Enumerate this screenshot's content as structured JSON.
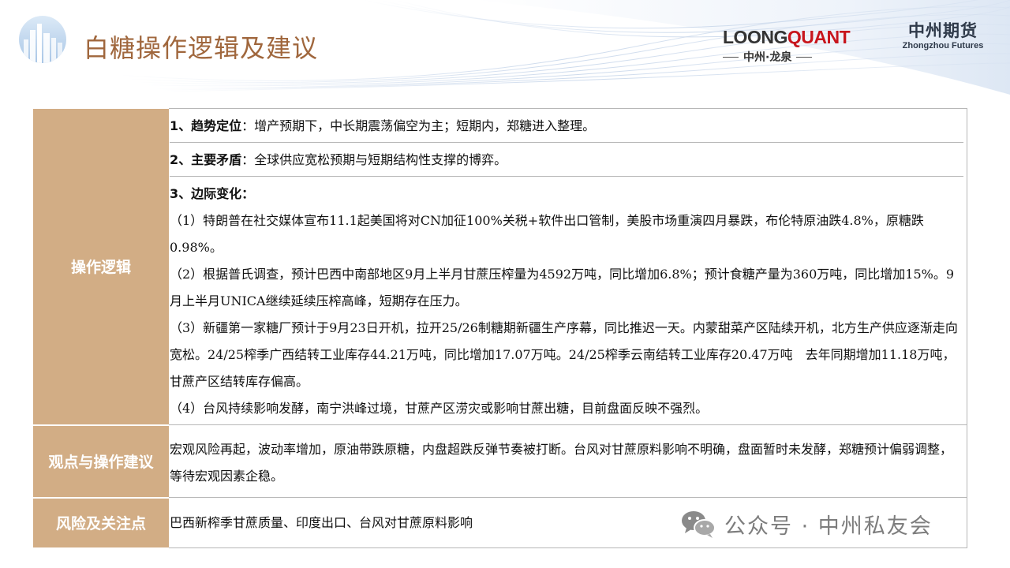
{
  "header": {
    "title": "白糖操作逻辑及建议",
    "brand_loong": "LOONG",
    "brand_quant": "QUANT",
    "brand_loong_sub": "中州·龙泉",
    "brand_zz_cn": "中州期货",
    "brand_zz_en": "Zhongzhou Futures"
  },
  "rows": {
    "logic": {
      "label": "操作逻辑",
      "trend": {
        "title": "1、趋势定位",
        "text": "：增产预期下，中长期震荡偏空为主；短期内，郑糖进入整理。"
      },
      "conflict": {
        "title": "2、主要矛盾",
        "text": "：全球供应宽松预期与短期结构性支撑的博弈。"
      },
      "margin": {
        "title": "3、边际变化：",
        "items": [
          "（1）特朗普在社交媒体宣布11.1起美国将对CN加征100%关税+软件出口管制，美股市场重演四月暴跌，布伦特原油跌4.8%，原糖跌0.98%。",
          "（2）根据普氏调查，预计巴西中南部地区9月上半月甘蔗压榨量为4592万吨，同比增加6.8%；预计食糖产量为360万吨，同比增加15%。9月上半月UNICA继续延续压榨高峰，短期存在压力。",
          "（3）新疆第一家糖厂预计于9月23日开机，拉开25/26制糖期新疆生产序幕，同比推迟一天。内蒙甜菜产区陆续开机，北方生产供应逐渐走向宽松。24/25榨季广西结转工业库存44.21万吨，同比增加17.07万吨。24/25榨季云南结转工业库存20.47万吨　去年同期增加11.18万吨，甘蔗产区结转库存偏高。",
          "（4）台风持续影响发酵，南宁洪峰过境，甘蔗产区涝灾或影响甘蔗出糖，目前盘面反映不强烈。"
        ]
      }
    },
    "advice": {
      "label": "观点与操作建议",
      "text": "宏观风险再起，波动率增加，原油带跌原糖，内盘超跌反弹节奏被打断。台风对甘蔗原料影响不明确，盘面暂时未发酵，郑糖预计偏弱调整，等待宏观因素企稳。"
    },
    "risk": {
      "label": "风险及关注点",
      "text": "巴西新榨季甘蔗质量、印度出口、台风对甘蔗原料影响"
    }
  },
  "watermark": {
    "text": "公众号 · 中州私友会",
    "icon": "wechat-icon"
  }
}
